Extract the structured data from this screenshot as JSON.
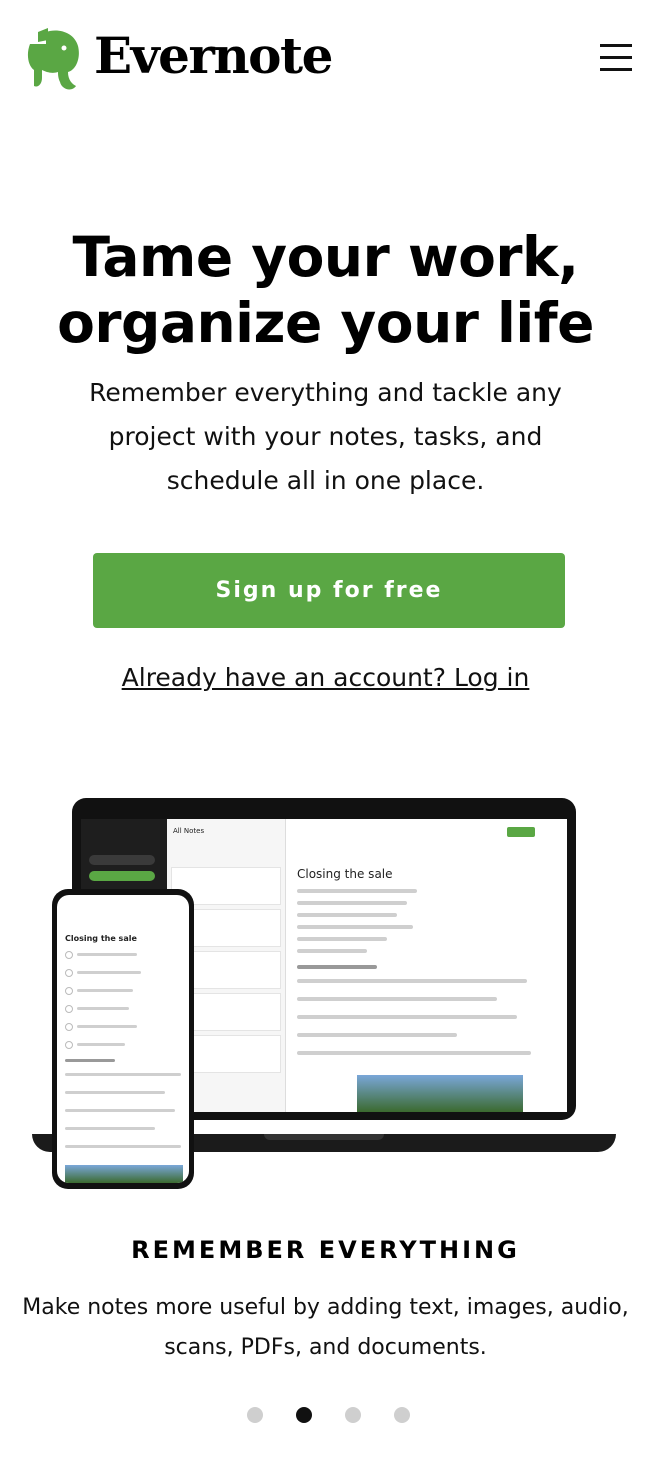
{
  "header": {
    "logo_text": "Evernote",
    "logo_icon": "elephant-logo-icon",
    "menu_icon": "hamburger-menu-icon",
    "brand_color": "#5aa744"
  },
  "hero": {
    "title_line1": "Tame your work,",
    "title_line2": "organize your life",
    "subtitle": "Remember everything and tackle any project with your notes, tasks, and schedule all in one place.",
    "cta_label": "Sign up for free",
    "login_label": "Already have an account? Log in"
  },
  "illustration": {
    "laptop_list_header": "All Notes",
    "note_title": "Closing the sale",
    "phone_note_title": "Closing the sale"
  },
  "feature": {
    "title": "REMEMBER EVERYTHING",
    "body_line1": "Make notes more useful by adding text, images, audio,",
    "body_line2": "scans, PDFs, and documents."
  },
  "carousel": {
    "slide_count": 4,
    "active_index": 1
  }
}
